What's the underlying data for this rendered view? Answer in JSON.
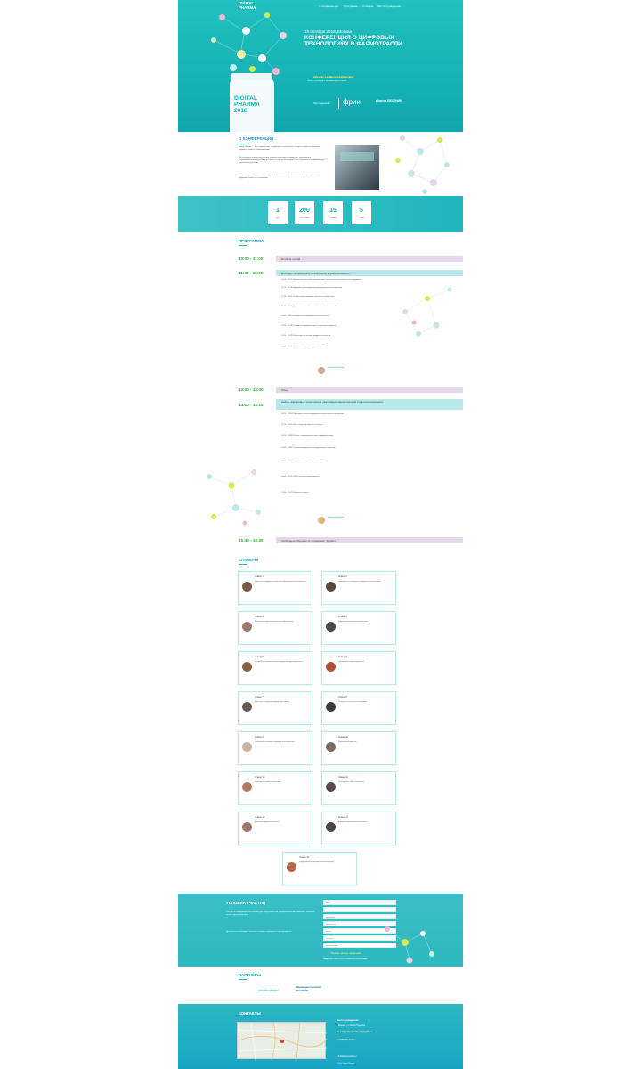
{
  "colors": {
    "teal": "#1fb5bd",
    "green": "#2bb32b",
    "lavender": "#e5d6e9",
    "light_teal": "#b7e8ea",
    "lime": "#d7e94e",
    "pink": "#f3b7d1"
  },
  "header": {
    "logo": "DIGITAL\nPHARMA",
    "nav": [
      "О конференции",
      "Программа",
      "Спикеры",
      "Место проведения"
    ],
    "date": "19 октября 2018, Москва",
    "title": "КОНФЕРЕНЦИЯ О ЦИФРОВЫХ ТЕХНОЛОГИЯХ В ФАРМОТРАСЛИ",
    "register": "ПРИЕМ ЗАЯВОК ЗАВЕРШЕН",
    "register_sub": "Узнать что-нибудь у организаторов встречи",
    "support_label": "При поддержке",
    "sponsor1": "фрии",
    "sponsor2": "pharma ВЕСТНИК",
    "bottle": "DIGITAL PHARMA 2018"
  },
  "about": {
    "heading": "О КОНФЕРЕНЦИИ",
    "p1": "Digital Pharma — это конференция о цифровых технологиях, которые помогают увеличить продажи и бизнес фармкомпаний.",
    "p2": "Мы освещаем самые актуальные вопросы перехода на цифру: от маркетинга и фармацевтической логистики до CRM-систем, от взаимодействия с врачами и пациентами до управления данными.",
    "p3": "Конференция собирает представителей фармкомпаний, аптечных сетей, дистрибьюторов, цифровых агентств и стартапов."
  },
  "stats": [
    {
      "n": "1",
      "l": "день"
    },
    {
      "n": "200",
      "l": "участников"
    },
    {
      "n": "15",
      "l": "спикеров"
    },
    {
      "n": "5",
      "l": "сессий"
    }
  ],
  "program": {
    "heading": "ПРОГРАММА",
    "slots": [
      {
        "time": "10:00 - 11:00",
        "label": "Встреча гостей"
      },
      {
        "time": "11:00 - 13:00",
        "label": "Доклады «Фармацевтический рынок в цифровизации»"
      },
      {
        "time": "13:00 - 14:00",
        "label": "Обед"
      },
      {
        "time": "14:00 - 15:15",
        "label": "Кейсы «Цифровые технологии в реализации маркетинговой стратегии компании»"
      },
      {
        "time": "15:40 - 16:30",
        "label": "Свободное общение со спикерами, фуршет"
      }
    ],
    "items1": [
      "11:00 – 11:15 Приветственное слово организатора. Как новые технологии меняют фармрынок",
      "11:15 – 11:30 Цифровая трансформация фармацевтической компании",
      "11:30 – 11:45 Онлайн-коммуникации с врачами и пациентами",
      "11:45 – 12:00 Данные и аналитика в маркетинге фармкомпаний",
      "12:00 – 12:15 Электронная коммерция и аптечные сети",
      "12:15 – 12:30 Стартапы в фармацевтике: от идеи до внедрения",
      "12:30 – 12:45 Регуляторные аспекты цифровых решений",
      "12:45 – 13:00 Дискуссия: будущее цифровой фармы"
    ],
    "moderator1": "Модератор сессии",
    "items2": [
      "14:00 – 14:10 Цифровые каналы продвижения рецептурных препаратов",
      "14:10 – 14:20 Кейс: запуск препарата в онлайне",
      "14:20 – 14:30 Работа с лидерами мнений в цифровой среде",
      "14:30 – 14:40 Персонализированные коммуникации с врачами",
      "14:40 – 14:50 Цифровые сервисы для пациентов",
      "14:50 – 15:00 CRM-системы в фармацевтике",
      "15:00 – 15:15 Вопросы и ответы"
    ],
    "moderator2": "Модератор сессии"
  },
  "speakers": {
    "heading": "СПИКЕРЫ",
    "cards": [
      {
        "name": "Спикер 1",
        "desc": "Директор по цифровому маркетингу фармацевтической компании"
      },
      {
        "name": "Спикер 2",
        "desc": "Руководитель направления цифровых коммуникаций"
      },
      {
        "name": "Спикер 3",
        "desc": "Генеральный директор аналитической компании"
      },
      {
        "name": "Спикер 4",
        "desc": "Директор по развитию аптечной сети"
      },
      {
        "name": "Спикер 5",
        "desc": "Основатель стартапа в области цифрового здравоохранения"
      },
      {
        "name": "Спикер 6",
        "desc": "Руководитель отдела маркетинга"
      },
      {
        "name": "Спикер 7",
        "desc": "Директор по продажам фармдистрибьютора"
      },
      {
        "name": "Спикер 8",
        "desc": "Эксперт по электронной коммерции"
      },
      {
        "name": "Спикер 9",
        "desc": "Руководитель проектов цифровой трансформации"
      },
      {
        "name": "Спикер 10",
        "desc": "Медицинский директор"
      },
      {
        "name": "Спикер 11",
        "desc": "Директор по работе с клиентами"
      },
      {
        "name": "Спикер 12",
        "desc": "Руководитель CRM-направления"
      },
      {
        "name": "Спикер 13",
        "desc": "Директор цифрового агентства"
      },
      {
        "name": "Спикер 14",
        "desc": "Аналитик фармацевтического рынка"
      },
      {
        "name": "Спикер 15",
        "desc": "Модератор конференции, главный редактор"
      }
    ]
  },
  "conditions": {
    "heading": "УСЛОВИЯ УЧАСТИЯ",
    "text1": "Участие в конференции бесплатное для представителей фармацевтических компаний, аптечных сетей и дистрибьюторов.",
    "text2": "Для участия необходимо заполнить заявку и дождаться подтверждения.",
    "fields": [
      "Имя",
      "Фамилия",
      "Компания",
      "Должность",
      "E-mail",
      "Телефон",
      "Комментарий"
    ],
    "closed": "Прием заявок завершен",
    "closed_sub": "Будем рады видеть вас на следующих мероприятиях"
  },
  "partners": {
    "heading": "ПАРТНЕРЫ",
    "p1": "pharmabrain",
    "p2": "Фармацевтический ВЕСТНИК"
  },
  "contacts": {
    "heading": "КОНТАКТЫ",
    "venue_label": "Место проведения:",
    "venue": "г. Москва, ул. Малая Ордынка",
    "org_label": "По вопросам участия обращайтесь:",
    "phone": "+7 (495) 000-00-00",
    "email": "info@pharmvestnik.ru",
    "copyright": "© 2018 Digital Pharma"
  }
}
